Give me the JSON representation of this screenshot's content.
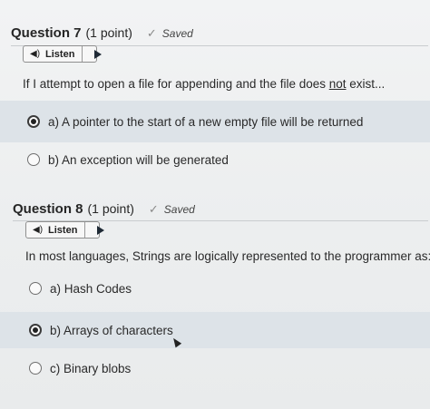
{
  "colors": {
    "selected_row_bg": "#dde3e8",
    "page_bg": "#eef0f1",
    "play_icon": "#1f2a36"
  },
  "questions": [
    {
      "title": "Question 7",
      "points": "(1 point)",
      "saved": "Saved",
      "listen_label": "Listen",
      "prompt_before": "If I attempt to open a file for appending and the file does ",
      "prompt_underlined": "not",
      "prompt_after": " exist...",
      "options": [
        {
          "text": "a) A pointer to the start of a new empty file will be returned",
          "selected": true
        },
        {
          "text": "b) An exception will be generated",
          "selected": false
        }
      ]
    },
    {
      "title": "Question 8",
      "points": "(1 point)",
      "saved": "Saved",
      "listen_label": "Listen",
      "prompt": "In most languages, Strings are logically represented to the programmer as:",
      "options": [
        {
          "text": "a) Hash Codes",
          "selected": false
        },
        {
          "text": "b) Arrays of characters",
          "selected": true
        },
        {
          "text": "c) Binary blobs",
          "selected": false
        }
      ]
    }
  ],
  "icons": {
    "saved": "check-icon",
    "listen": "speaker-icon",
    "play": "play-icon"
  }
}
